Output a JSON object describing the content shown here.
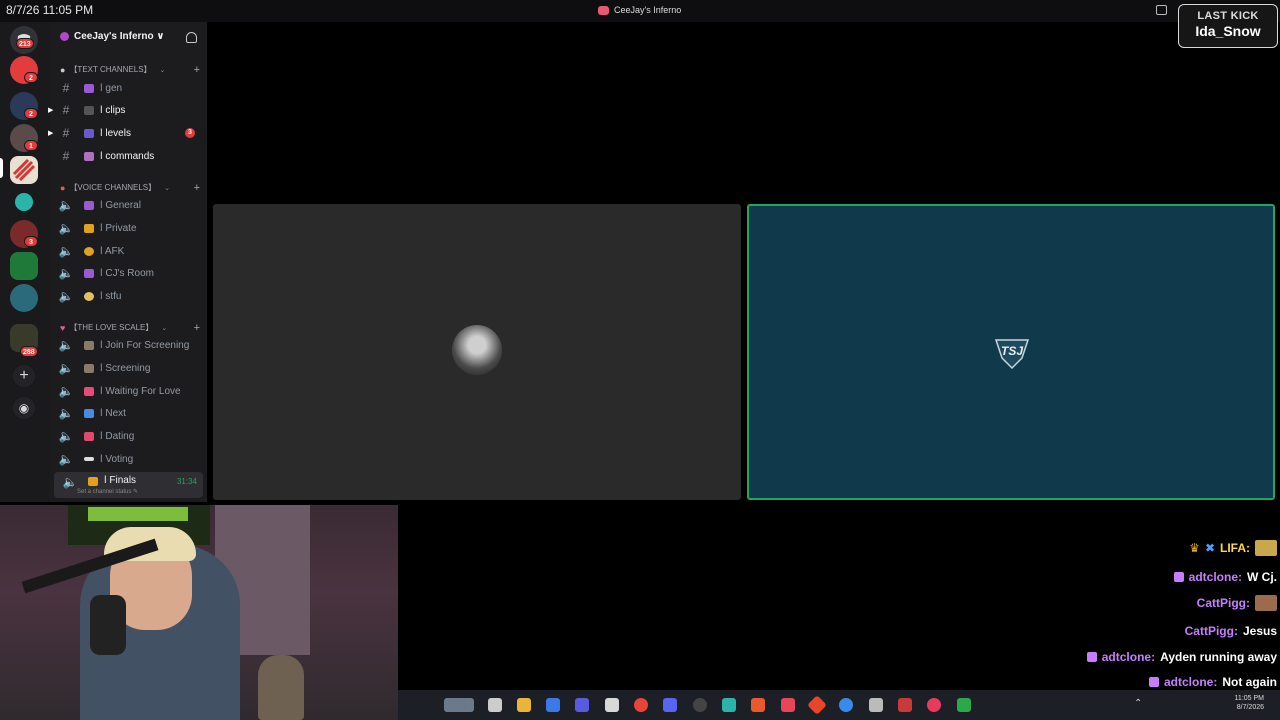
{
  "topbar": {
    "stamp": "8/7/26 11:05 PM",
    "window_title": "CeeJay's Inferno"
  },
  "last_kick": {
    "label": "LAST KICK",
    "name": "Ida_Snow"
  },
  "server_rail": {
    "badges": [
      "213",
      "2",
      "2",
      "1",
      "3",
      "288"
    ]
  },
  "server": {
    "name": "CeeJay's Inferno ∨"
  },
  "categories": [
    {
      "label": "【TEXT CHANNELS】"
    },
    {
      "label": "【VOICE CHANNELS】"
    },
    {
      "label": "【THE LOVE SCALE】"
    }
  ],
  "text_channels": [
    {
      "name": "ǀ gen"
    },
    {
      "name": "ǀ clips"
    },
    {
      "name": "ǀ levels",
      "badge": "3"
    },
    {
      "name": "ǀ commands"
    }
  ],
  "voice_channels": [
    {
      "name": "ǀ General"
    },
    {
      "name": "ǀ Private"
    },
    {
      "name": "ǀ AFK"
    },
    {
      "name": "ǀ CJ's Room"
    },
    {
      "name": "ǀ stfu"
    }
  ],
  "love_channels": [
    {
      "name": "ǀ Join For Screening"
    },
    {
      "name": "ǀ Screening"
    },
    {
      "name": "ǀ Waiting For Love"
    },
    {
      "name": "ǀ Next"
    },
    {
      "name": "ǀ Dating"
    },
    {
      "name": "ǀ Voting"
    },
    {
      "name": "ǀ Finals",
      "time": "31:34",
      "status": "Set a channel status ✎"
    }
  ],
  "chat": [
    {
      "user": "LIFA:",
      "text": ""
    },
    {
      "user": "adtclone:",
      "text": "W Cj."
    },
    {
      "user": "CattPigg:",
      "text": ""
    },
    {
      "user": "CattPigg:",
      "text": "Jesus"
    },
    {
      "user": "adtclone:",
      "text": "Ayden running away"
    },
    {
      "user": "adtclone:",
      "text": "Not again"
    }
  ],
  "taskbar": {
    "time": "11:05 PM",
    "date": "8/7/2026"
  },
  "colors": {
    "accent_green": "#23a55a",
    "badge_red": "#e23c3c",
    "chat_purple": "#c77dff",
    "stream_tile": "#11394c"
  }
}
